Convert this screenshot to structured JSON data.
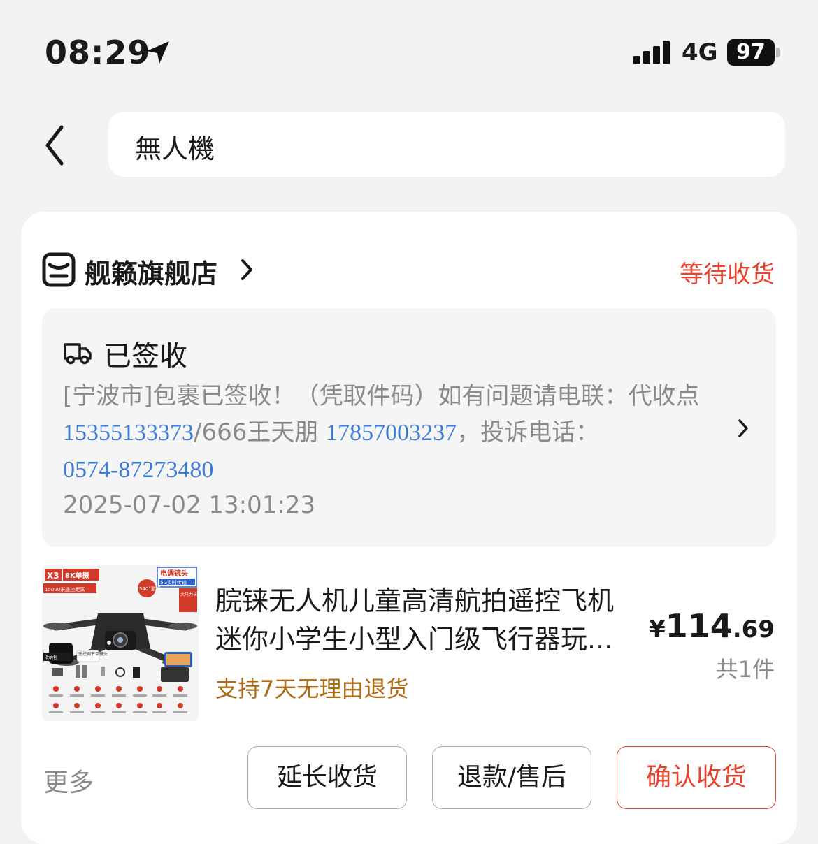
{
  "status_bar": {
    "time": "08:29",
    "network": "4G",
    "battery": "97",
    "location_icon": "location-arrow-icon",
    "signal_icon": "signal-bars-icon"
  },
  "search": {
    "query": "無人機",
    "back_icon": "chevron-left-icon"
  },
  "order": {
    "shop_name": "舰籁旗舰店",
    "shop_icon": "store-icon",
    "status": "等待收货",
    "status_color": "#e8412c",
    "logistics": {
      "title": "已签收",
      "desc_part1": "[宁波市]包裹已签收！（凭取件码）如有问题请电联：代收点 ",
      "phone1": "15355133373",
      "desc_part2": "/666王天朋 ",
      "phone2": "17857003237",
      "desc_part3": "，投诉电话：",
      "phone3": "0574-87273480",
      "time": "2025-07-02 13:01:23",
      "link_color": "#3d7bd9"
    },
    "product": {
      "title_line1": "脘铼无人机儿童高清航拍遥控飞机",
      "title_line2": "迷你小学生小型入门级飞行器玩...",
      "return_policy": "支持7天无理由退货",
      "price_symbol": "¥",
      "price_int": "114",
      "price_dec": ".69",
      "quantity": "共1件",
      "image_labels": {
        "model": "X3",
        "camera": "8K单摄",
        "range": "15000米遥控距离",
        "lens": "电调镜头",
        "transfer": "5G实时传输",
        "avoid": "540°避障",
        "motor": "大马力长续航",
        "single_lens": "遥控调节单镜头",
        "bag": "收纳包"
      }
    },
    "actions": {
      "more": "更多",
      "extend": "延长收货",
      "refund": "退款/售后",
      "confirm": "确认收货"
    }
  }
}
